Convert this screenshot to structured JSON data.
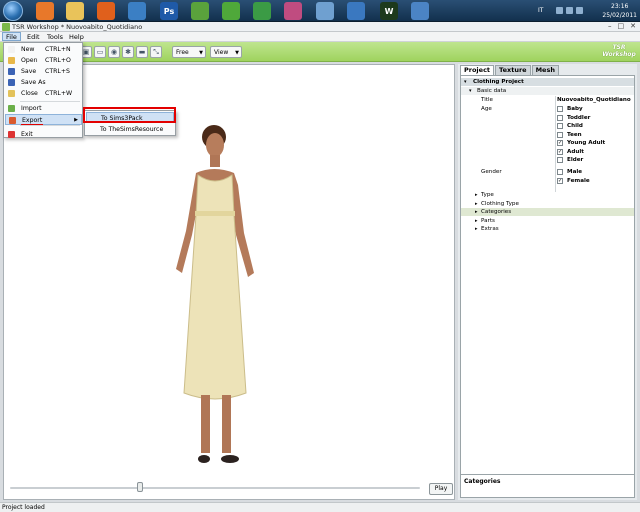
{
  "taskbar": {
    "icons": [
      {
        "name": "media-player-icon",
        "color": "#e8782a"
      },
      {
        "name": "folder-icon",
        "color": "#e9c35a"
      },
      {
        "name": "firefox-icon",
        "color": "#e0601c"
      },
      {
        "name": "globe-icon",
        "color": "#3b7fc4"
      },
      {
        "name": "photoshop-icon",
        "label": "Ps",
        "color": "#1f5aa8"
      },
      {
        "name": "app-icon-1",
        "color": "#5aa23c"
      },
      {
        "name": "app-icon-2",
        "color": "#4fa83a"
      },
      {
        "name": "app-icon-3",
        "color": "#3b9b45"
      },
      {
        "name": "app-icon-4",
        "color": "#c04c80"
      },
      {
        "name": "network-icon",
        "color": "#6fa0d0"
      },
      {
        "name": "browser-icon",
        "color": "#3a78c0"
      },
      {
        "name": "workshop-icon",
        "label": "W",
        "color": "#1d3a1c"
      },
      {
        "name": "tool-icon",
        "color": "#4b84c5"
      }
    ],
    "lang": "IT",
    "time": "23:16",
    "date": "25/02/2011"
  },
  "window": {
    "title": "TSR Workshop * Nuovoabito_Quotidiano",
    "controls": {
      "minimize": "–",
      "maximize": "□",
      "close": "✕"
    }
  },
  "menubar": {
    "items": [
      "File",
      "Edit",
      "Tools",
      "Help"
    ]
  },
  "logo": {
    "line1": "TSR",
    "line2": "Workshop"
  },
  "toolbar": {
    "buttons": [
      "▣",
      "▭",
      "◉",
      "✱",
      "▬",
      "⤡"
    ],
    "mode_dropdown": "Free",
    "view_dropdown": "View"
  },
  "file_menu": {
    "items": [
      {
        "label": "New",
        "shortcut": "CTRL+N",
        "icon_color": "#f2f2f2"
      },
      {
        "label": "Open",
        "shortcut": "CTRL+O",
        "icon_color": "#e8b84a"
      },
      {
        "label": "Save",
        "shortcut": "CTRL+S",
        "icon_color": "#3b63b5"
      },
      {
        "label": "Save As",
        "shortcut": "",
        "icon_color": "#3b63b5"
      },
      {
        "label": "Close",
        "shortcut": "CTRL+W",
        "icon_color": "#e3c25a"
      },
      {
        "label": "Import",
        "shortcut": "",
        "icon_color": "#6cb04a"
      },
      {
        "label": "Export",
        "shortcut": "",
        "icon_color": "#d95a2e"
      },
      {
        "label": "Exit",
        "shortcut": "",
        "icon_color": "#d33"
      }
    ],
    "submenu_arrow": "▶"
  },
  "export_submenu": {
    "items": [
      "To Sims3Pack",
      "To TheSimsResource"
    ]
  },
  "viewport": {
    "play_label": "Play",
    "timeline_position": 0.31
  },
  "panel": {
    "tabs": [
      "Project",
      "Texture",
      "Mesh"
    ],
    "root": "Clothing Project",
    "basic_data": "Basic data",
    "title_label": "Title",
    "title_value": "Nuovoabito_Quotidiano",
    "age_label": "Age",
    "ages": [
      {
        "label": "Baby",
        "checked": false
      },
      {
        "label": "Toddler",
        "checked": false
      },
      {
        "label": "Child",
        "checked": false
      },
      {
        "label": "Teen",
        "checked": false
      },
      {
        "label": "Young Adult",
        "checked": true
      },
      {
        "label": "Adult",
        "checked": true
      },
      {
        "label": "Elder",
        "checked": false
      }
    ],
    "gender_label": "Gender",
    "genders": [
      {
        "label": "Male",
        "checked": false
      },
      {
        "label": "Female",
        "checked": true
      }
    ],
    "groups": [
      "Type",
      "Clothing Type",
      "Categories",
      "Parts",
      "Extras"
    ],
    "check_mark": "✓",
    "expand_glyph": "▸",
    "collapse_glyph": "▾",
    "categories_title": "Categories"
  },
  "status": {
    "text": "Project loaded"
  }
}
